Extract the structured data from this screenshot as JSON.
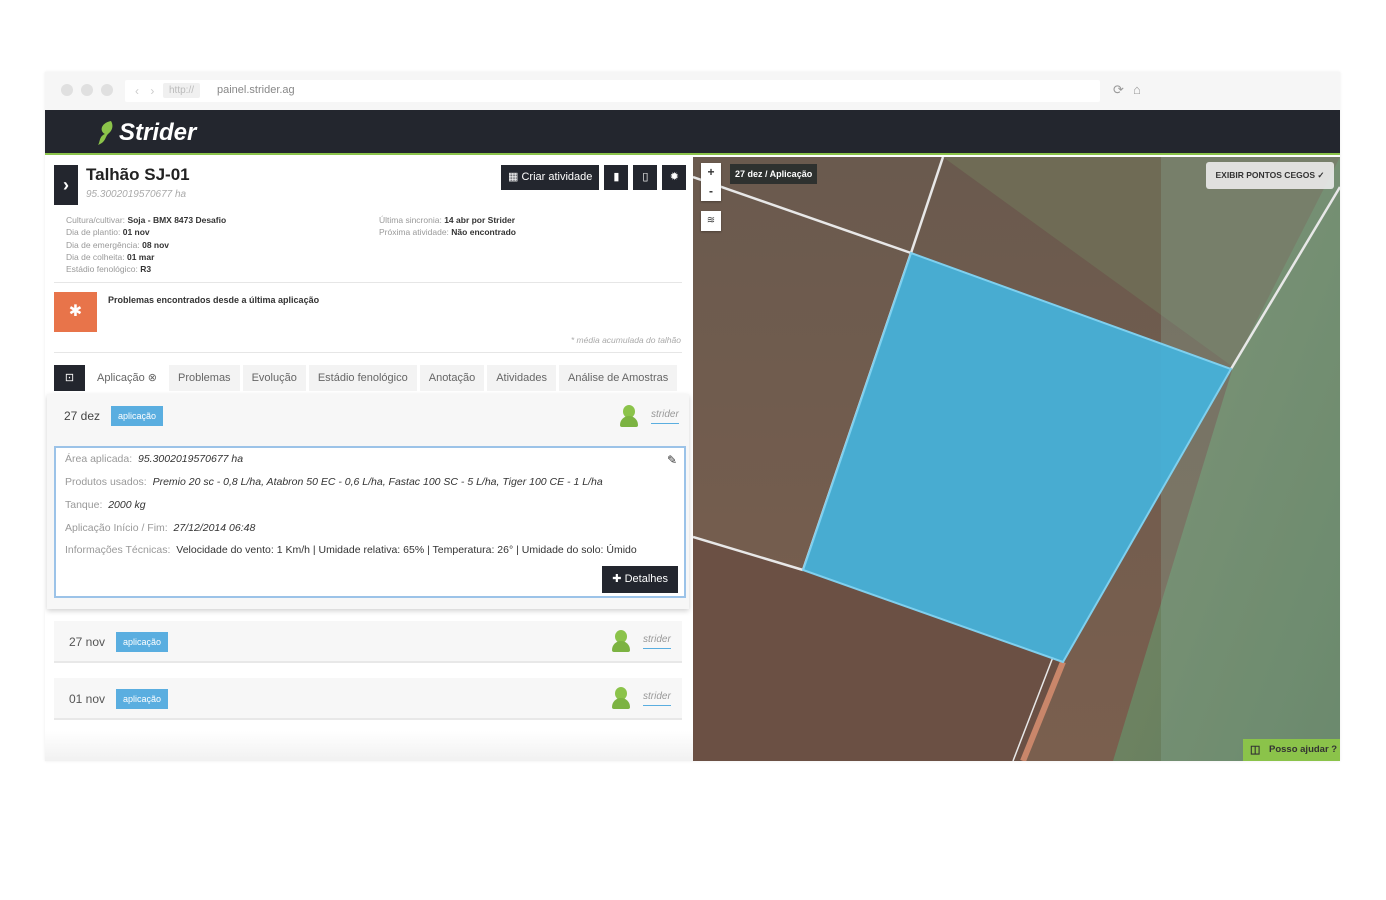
{
  "browser": {
    "nav_arrows": "‹ ›",
    "protocol": "http://",
    "url": "painel.strider.ag",
    "reload_icon": "reload-icon",
    "home_icon": "home-icon"
  },
  "app": {
    "brand": "Strider",
    "accent": "#8bc34a",
    "header_color": "#23262e"
  },
  "field": {
    "title": "Talhão SJ-01",
    "area": "95.3002019570677 ha",
    "create_activity_label": "Criar atividade",
    "info_left": [
      {
        "label": "Cultura/cultivar:",
        "value": "Soja - BMX 8473 Desafio"
      },
      {
        "label": "Dia de plantio:",
        "value": "01 nov"
      },
      {
        "label": "Dia de emergência:",
        "value": "08 nov"
      },
      {
        "label": "Dia de colheita:",
        "value": "01 mar"
      },
      {
        "label": "Estádio fenológico:",
        "value": "R3"
      }
    ],
    "info_right": [
      {
        "label": "Última sincronia:",
        "value": "14 abr por Strider"
      },
      {
        "label": "Próxima atividade:",
        "value": "Não encontrado"
      }
    ],
    "problems_text": "Problemas encontrados desde a última aplicação",
    "footnote": "* média acumulada do talhão"
  },
  "tabs": [
    "Aplicação",
    "Problemas",
    "Evolução",
    "Estádio fenológico",
    "Anotação",
    "Atividades",
    "Análise de Amostras"
  ],
  "timeline": {
    "expanded": {
      "date": "27 dez",
      "badge": "aplicação",
      "user": "strider",
      "rows": [
        {
          "label": "Área aplicada:",
          "value": "95.3002019570677 ha"
        },
        {
          "label": "Produtos usados:",
          "value": "Premio 20 sc - 0,8 L/ha,  Atabron 50 EC - 0,6 L/ha,  Fastac 100 SC - 5 L/ha,  Tiger 100 CE - 1 L/ha"
        },
        {
          "label": "Tanque:",
          "value": "2000 kg"
        },
        {
          "label": "Aplicação Início / Fim:",
          "value": "27/12/2014 06:48"
        },
        {
          "label": "Informações Técnicas:",
          "value": "Velocidade do vento: 1 Km/h | Umidade relativa: 65% | Temperatura: 26° | Umidade do solo: Úmido"
        }
      ],
      "details_label": "Detalhes"
    },
    "items": [
      {
        "date": "27 nov",
        "badge": "aplicação",
        "user": "strider"
      },
      {
        "date": "01 nov",
        "badge": "aplicação",
        "user": "strider"
      }
    ]
  },
  "map": {
    "zoom_in": "+",
    "zoom_out": "-",
    "label": "27 dez / Aplicação",
    "blind_spots_button": "EXIBIR PONTOS CEGOS ✓",
    "field_color": "#45b3dc",
    "help_label": "Posso ajudar ?"
  }
}
